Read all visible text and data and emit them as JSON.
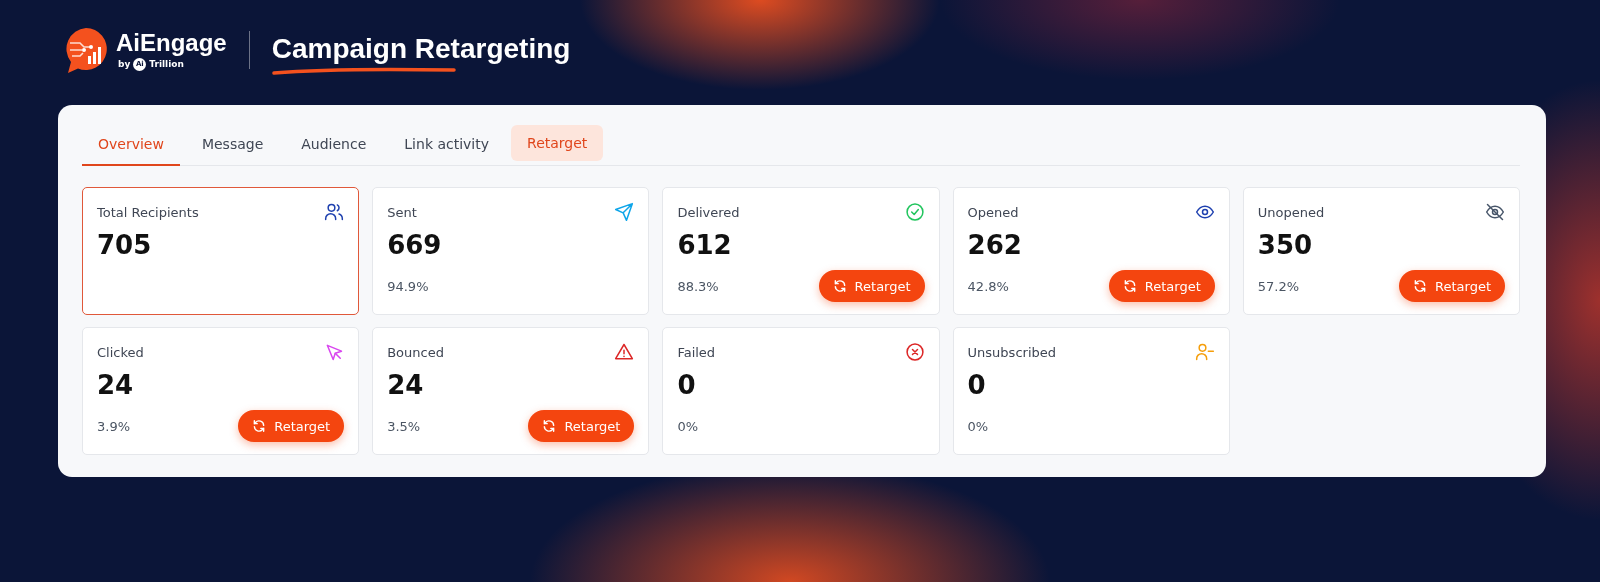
{
  "header": {
    "brand": "AiEngage",
    "byline": {
      "by": "by",
      "badge": "Ai",
      "company": "Trillion"
    },
    "title": "Campaign Retargeting"
  },
  "tabs": [
    {
      "label": "Overview",
      "selected": true,
      "highlighted": false
    },
    {
      "label": "Message",
      "selected": false,
      "highlighted": false
    },
    {
      "label": "Audience",
      "selected": false,
      "highlighted": false
    },
    {
      "label": "Link activity",
      "selected": false,
      "highlighted": false
    },
    {
      "label": "Retarget",
      "selected": false,
      "highlighted": true
    }
  ],
  "cards": [
    {
      "kind": "recipients",
      "label": "Total Recipients",
      "value": "705",
      "selected": true,
      "color": "#1e40af"
    },
    {
      "kind": "sent",
      "label": "Sent",
      "value": "669",
      "rate": "94.9%",
      "selected": false,
      "color": "#0ea5e9"
    },
    {
      "kind": "delivered",
      "label": "Delivered",
      "value": "612",
      "rate": "88.3%",
      "button": "Retarget",
      "selected": false,
      "color": "#22c55e"
    },
    {
      "kind": "opened",
      "label": "Opened",
      "value": "262",
      "rate": "42.8%",
      "button": "Retarget",
      "selected": false,
      "color": "#1e40af"
    },
    {
      "kind": "unopened",
      "label": "Unopened",
      "value": "350",
      "rate": "57.2%",
      "button": "Retarget",
      "selected": false,
      "color": "#475569"
    },
    {
      "kind": "clicked",
      "label": "Clicked",
      "value": "24",
      "rate": "3.9%",
      "button": "Retarget",
      "selected": false,
      "color": "#d946ef"
    },
    {
      "kind": "bounced",
      "label": "Bounced",
      "value": "24",
      "rate": "3.5%",
      "button": "Retarget",
      "selected": false,
      "color": "#dc2626"
    },
    {
      "kind": "failed",
      "label": "Failed",
      "value": "0",
      "rate": "0%",
      "selected": false,
      "color": "#dc2626"
    },
    {
      "kind": "unsubscribed",
      "label": "Unsubscribed",
      "value": "0",
      "rate": "0%",
      "selected": false,
      "color": "#f59e0b"
    }
  ]
}
